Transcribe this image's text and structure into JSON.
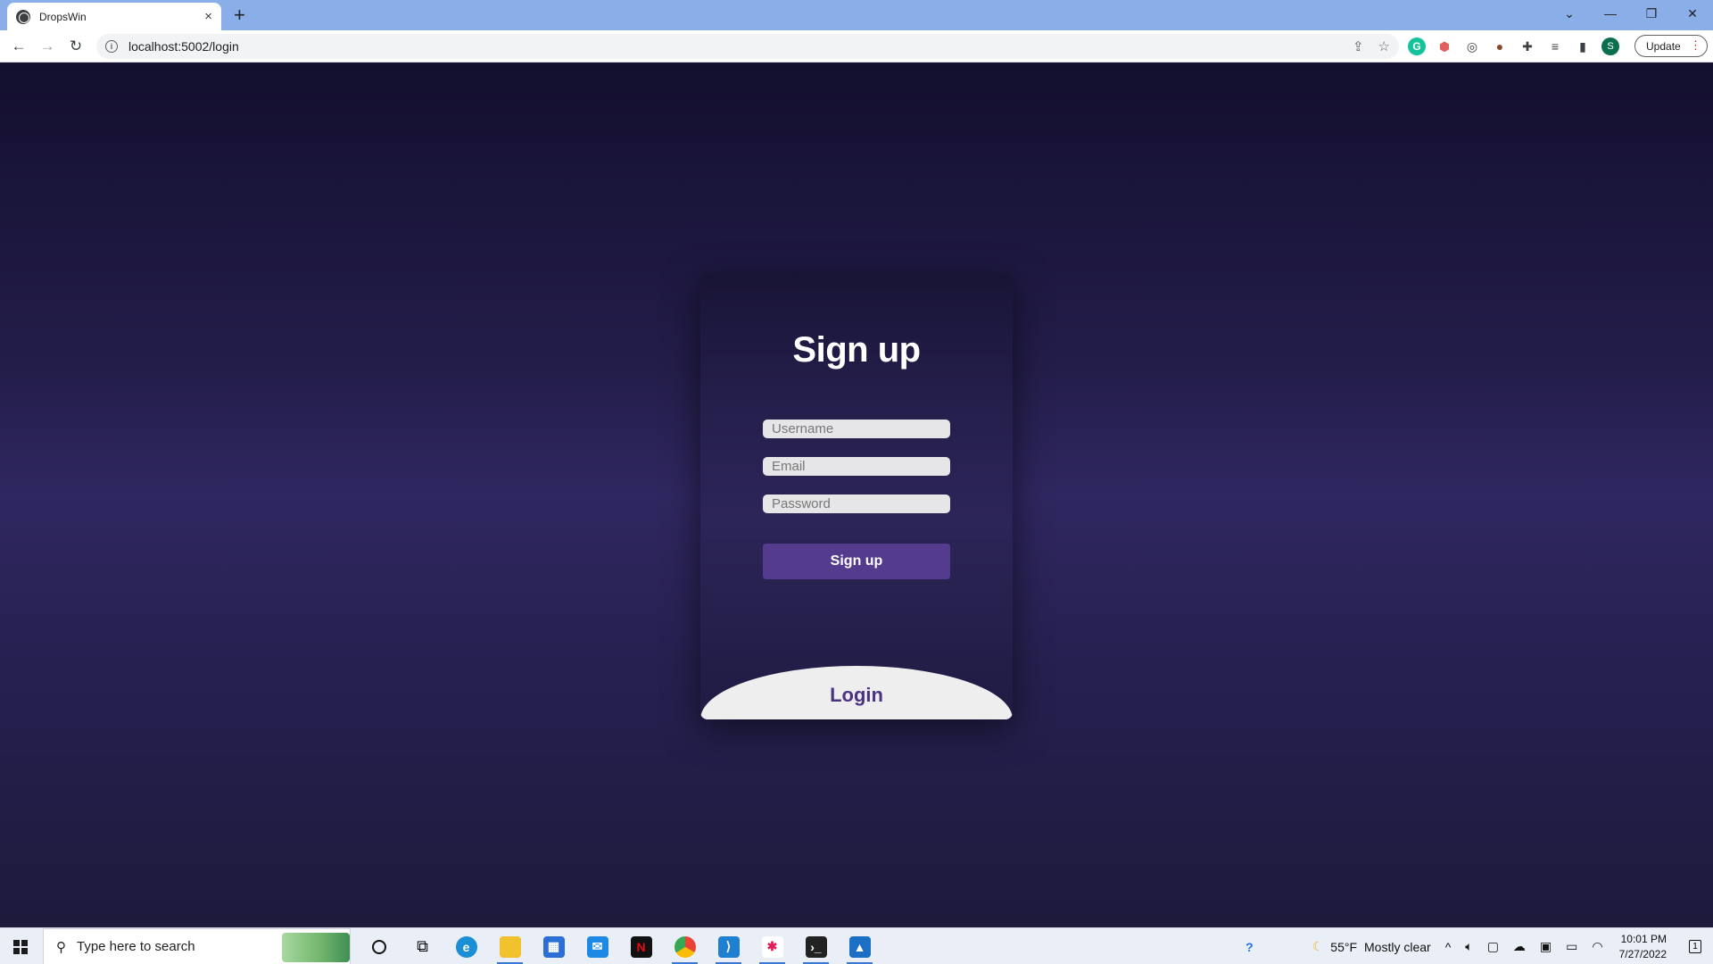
{
  "browser": {
    "tab_title": "DropsWin",
    "url": "localhost:5002/login",
    "update_label": "Update",
    "new_tab_symbol": "+",
    "close_symbol": "×"
  },
  "page": {
    "title": "Sign up",
    "username_placeholder": "Username",
    "email_placeholder": "Email",
    "password_placeholder": "Password",
    "submit_label": "Sign up",
    "login_label": "Login"
  },
  "taskbar": {
    "search_placeholder": "Type here to search",
    "weather_temp": "55°F",
    "weather_desc": "Mostly clear",
    "time": "10:01 PM",
    "date": "7/27/2022",
    "notification_count": "1"
  },
  "colors": {
    "card_button": "#553b8e",
    "login_text": "#4a3480",
    "page_bg": "#231d4a"
  },
  "icons": [
    "globe-icon",
    "back-icon",
    "forward-icon",
    "reload-icon",
    "info-icon",
    "share-icon",
    "star-icon",
    "grammarly-icon",
    "extension-icon",
    "puzzle-icon",
    "reading-list-icon",
    "sidebar-icon",
    "profile-avatar",
    "windows-logo",
    "search-icon",
    "cortana-icon",
    "task-view-icon",
    "edge-icon",
    "explorer-icon",
    "store-icon",
    "mail-icon",
    "netflix-icon",
    "chrome-icon",
    "vscode-icon",
    "slack-icon",
    "terminal-icon",
    "photos-icon"
  ]
}
